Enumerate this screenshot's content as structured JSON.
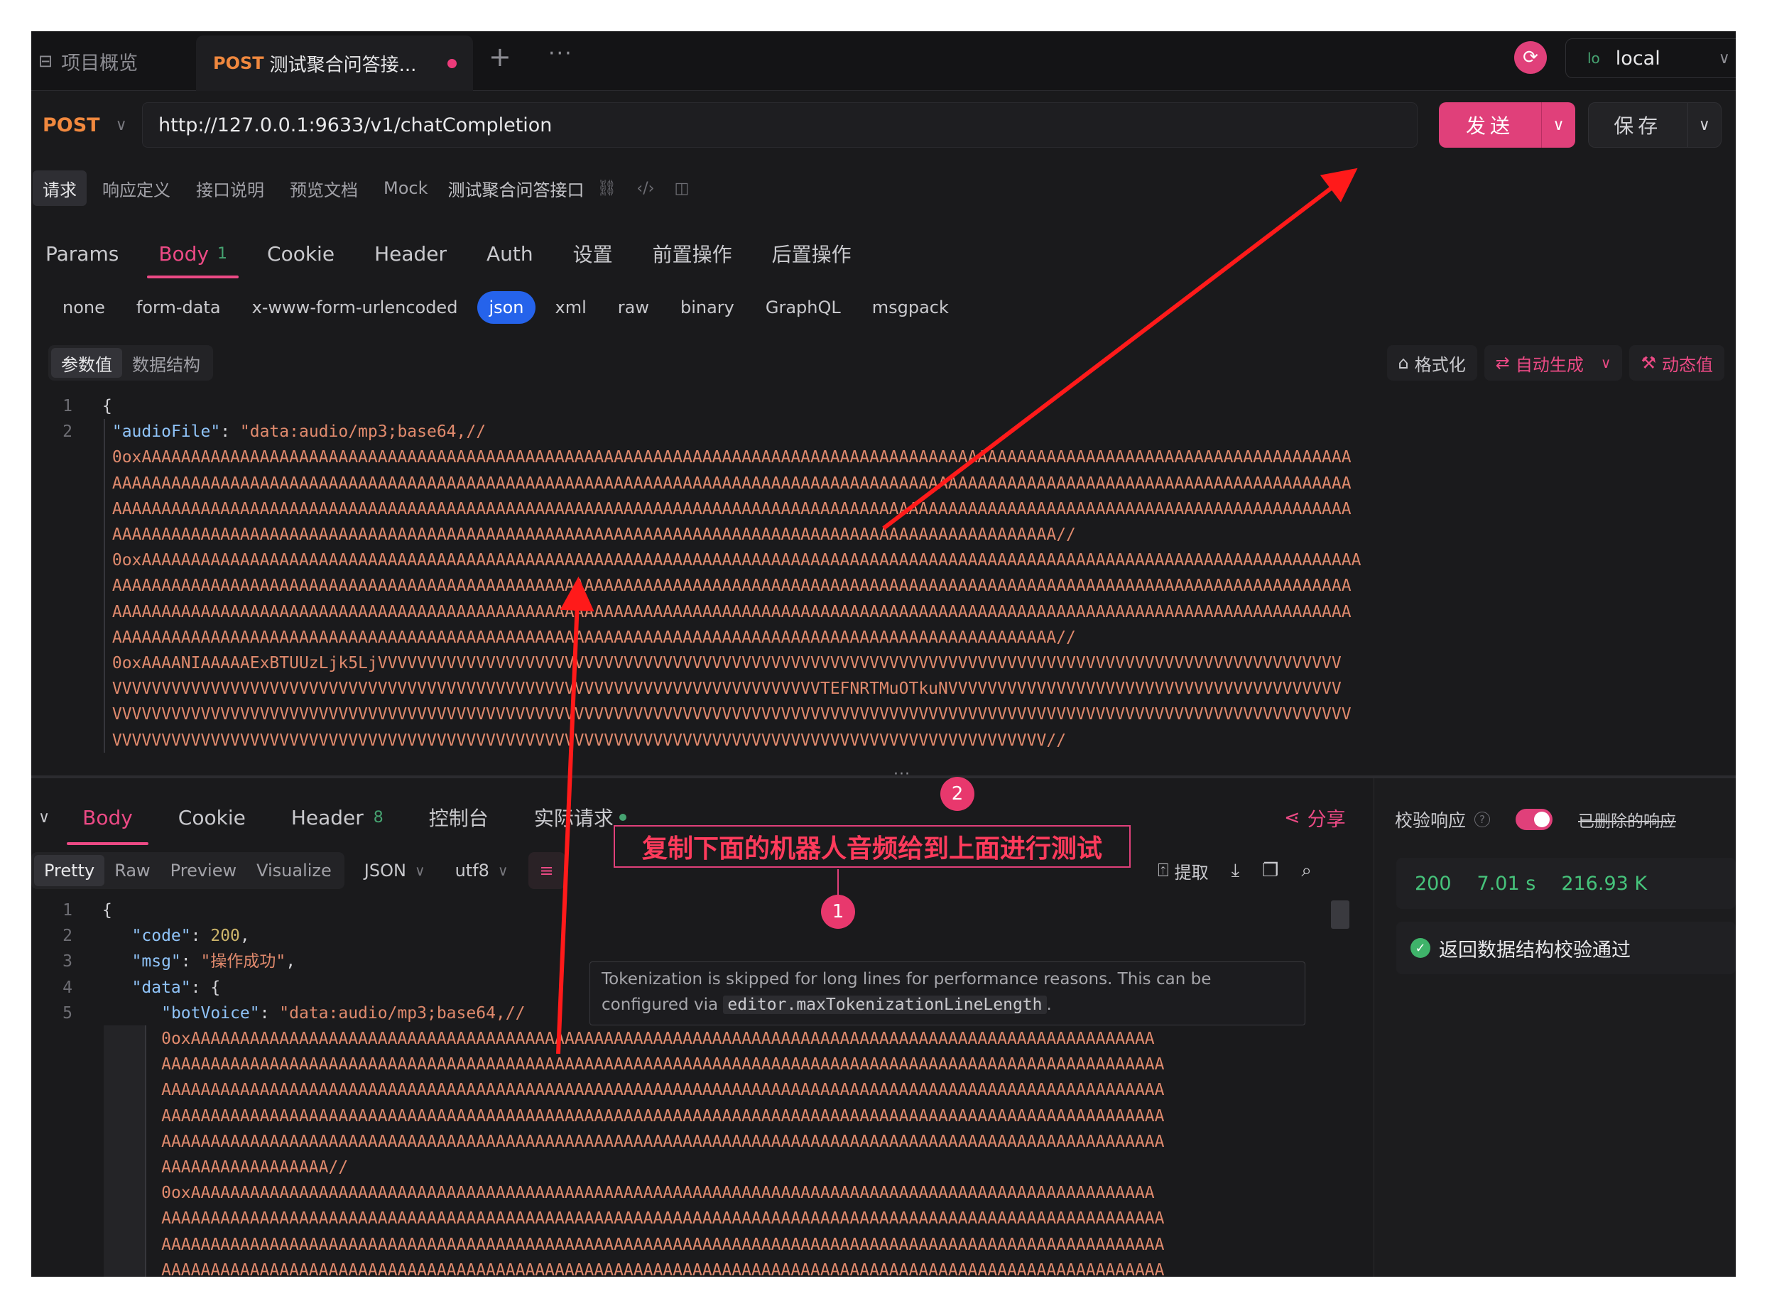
{
  "tabs": {
    "overview_label": "项目概览",
    "active": {
      "method": "POST",
      "name": "测试聚合问答接..."
    },
    "add": "+",
    "more": "···"
  },
  "environment": {
    "badge": "lo",
    "name": "local"
  },
  "request": {
    "method": "POST",
    "url": "http://127.0.0.1:9633/v1/chatCompletion",
    "send_label": "发送",
    "save_label": "保存"
  },
  "sub_tabs": [
    "请求",
    "响应定义",
    "接口说明",
    "预览文档",
    "Mock"
  ],
  "endpoint_title": "测试聚合问答接口",
  "param_tabs": [
    {
      "label": "Params"
    },
    {
      "label": "Body",
      "count": "1"
    },
    {
      "label": "Cookie"
    },
    {
      "label": "Header"
    },
    {
      "label": "Auth"
    },
    {
      "label": "设置"
    },
    {
      "label": "前置操作"
    },
    {
      "label": "后置操作"
    }
  ],
  "body_types": [
    "none",
    "form-data",
    "x-www-form-urlencoded",
    "json",
    "xml",
    "raw",
    "binary",
    "GraphQL",
    "msgpack"
  ],
  "value_modes": [
    "参数值",
    "数据结构"
  ],
  "request_tools": {
    "format": "格式化",
    "auto_generate": "自动生成",
    "dynamic": "动态值"
  },
  "request_body_lines": [
    {
      "num": "1",
      "text": "{"
    },
    {
      "num": "2",
      "key": "\"audioFile\"",
      "value": "\"data:audio/mp3;base64,//"
    },
    {
      "num": "",
      "value": "0oxAAAAAAAAAAAAAAAAAAAAAAAAAAAAAAAAAAAAAAAAAAAAAAAAAAAAAAAAAAAAAAAAAAAAAAAAAAAAAAAAAAAAAAAAAAAAAAAAAAAAAAAAAAAAAAAAAAAAAAAAAAA"
    },
    {
      "num": "",
      "value": "AAAAAAAAAAAAAAAAAAAAAAAAAAAAAAAAAAAAAAAAAAAAAAAAAAAAAAAAAAAAAAAAAAAAAAAAAAAAAAAAAAAAAAAAAAAAAAAAAAAAAAAAAAAAAAAAAAAAAAAAAAAAAA"
    },
    {
      "num": "",
      "value": "AAAAAAAAAAAAAAAAAAAAAAAAAAAAAAAAAAAAAAAAAAAAAAAAAAAAAAAAAAAAAAAAAAAAAAAAAAAAAAAAAAAAAAAAAAAAAAAAAAAAAAAAAAAAAAAAAAAAAAAAAAAAAA"
    },
    {
      "num": "",
      "value": "AAAAAAAAAAAAAAAAAAAAAAAAAAAAAAAAAAAAAAAAAAAAAAAAAAAAAAAAAAAAAAAAAAAAAAAAAAAAAAAAAAAAAAAAAAAAAAAA//"
    },
    {
      "num": "",
      "value": "0oxAAAAAAAAAAAAAAAAAAAAAAAAAAAAAAAAAAAAAAAAAAAAAAAAAAAAAAAAAAAAAAAAAAAAAAAAAAAAAAAAAAAAAAAAAAAAAAAAAAAAAAAAAAAAAAAAAAAAAAAAAAAA"
    },
    {
      "num": "",
      "value": "AAAAAAAAAAAAAAAAAAAAAAAAAAAAAAAAAAAAAAAAAAAAAAAAAAAAAAAAAAAAAAAAAAAAAAAAAAAAAAAAAAAAAAAAAAAAAAAAAAAAAAAAAAAAAAAAAAAAAAAAAAAAAA"
    },
    {
      "num": "",
      "value": "AAAAAAAAAAAAAAAAAAAAAAAAAAAAAAAAAAAAAAAAAAAAAAAAAAAAAAAAAAAAAAAAAAAAAAAAAAAAAAAAAAAAAAAAAAAAAAAAAAAAAAAAAAAAAAAAAAAAAAAAAAAAAA"
    },
    {
      "num": "",
      "value": "AAAAAAAAAAAAAAAAAAAAAAAAAAAAAAAAAAAAAAAAAAAAAAAAAAAAAAAAAAAAAAAAAAAAAAAAAAAAAAAAAAAAAAAAAAAAAAAA//"
    },
    {
      "num": "",
      "value": "0oxAAAANIAAAAAExBTUUzLjk5LjVVVVVVVVVVVVVVVVVVVVVVVVVVVVVVVVVVVVVVVVVVVVVVVVVVVVVVVVVVVVVVVVVVVVVVVVVVVVVVVVVVVVVVVVVVVVVVVVVV"
    },
    {
      "num": "",
      "value": "VVVVVVVVVVVVVVVVVVVVVVVVVVVVVVVVVVVVVVVVVVVVVVVVVVVVVVVVVVVVVVVVVVVVVVVVTEFNRTMuOTkuNVVVVVVVVVVVVVVVVVVVVVVVVVVVVVVVVVVVVVVVV"
    },
    {
      "num": "",
      "value": "VVVVVVVVVVVVVVVVVVVVVVVVVVVVVVVVVVVVVVVVVVVVVVVVVVVVVVVVVVVVVVVVVVVVVVVVVVVVVVVVVVVVVVVVVVVVVVVVVVVVVVVVVVVVVVVVVVVVVVVVVVVVVV"
    },
    {
      "num": "",
      "value": "VVVVVVVVVVVVVVVVVVVVVVVVVVVVVVVVVVVVVVVVVVVVVVVVVVVVVVVVVVVVVVVVVVVVVVVVVVVVVVVVVVVVVVVVVVVVVVV//"
    }
  ],
  "response": {
    "tabs": [
      {
        "label": "Body"
      },
      {
        "label": "Cookie"
      },
      {
        "label": "Header",
        "count": "8"
      },
      {
        "label": "控制台"
      },
      {
        "label": "实际请求"
      }
    ],
    "share_label": "分享",
    "formats": [
      "Pretty",
      "Raw",
      "Preview",
      "Visualize"
    ],
    "language": "JSON",
    "encoding": "utf8",
    "extract_label": "提取",
    "lines": [
      {
        "num": "1",
        "text": "{"
      },
      {
        "num": "2",
        "key": "\"code\"",
        "number": "200"
      },
      {
        "num": "3",
        "key": "\"msg\"",
        "value": "\"操作成功\""
      },
      {
        "num": "4",
        "key": "\"data\"",
        "text": "{"
      },
      {
        "num": "5",
        "key": "\"botVoice\"",
        "value": "\"data:audio/mp3;base64,//"
      },
      {
        "num": "",
        "value": "0oxAAAAAAAAAAAAAAAAAAAAAAAAAAAAAAAAAAAAAAAAAAAAAAAAAAAAAAAAAAAAAAAAAAAAAAAAAAAAAAAAAAAAAAAAAAAAAAAAAA"
      },
      {
        "num": "",
        "value": "AAAAAAAAAAAAAAAAAAAAAAAAAAAAAAAAAAAAAAAAAAAAAAAAAAAAAAAAAAAAAAAAAAAAAAAAAAAAAAAAAAAAAAAAAAAAAAAAAAAAAA"
      },
      {
        "num": "",
        "value": "AAAAAAAAAAAAAAAAAAAAAAAAAAAAAAAAAAAAAAAAAAAAAAAAAAAAAAAAAAAAAAAAAAAAAAAAAAAAAAAAAAAAAAAAAAAAAAAAAAAAAA"
      },
      {
        "num": "",
        "value": "AAAAAAAAAAAAAAAAAAAAAAAAAAAAAAAAAAAAAAAAAAAAAAAAAAAAAAAAAAAAAAAAAAAAAAAAAAAAAAAAAAAAAAAAAAAAAAAAAAAAAA"
      },
      {
        "num": "",
        "value": "AAAAAAAAAAAAAAAAAAAAAAAAAAAAAAAAAAAAAAAAAAAAAAAAAAAAAAAAAAAAAAAAAAAAAAAAAAAAAAAAAAAAAAAAAAAAAAAAAAAAAA"
      },
      {
        "num": "",
        "value": "AAAAAAAAAAAAAAAAA//"
      },
      {
        "num": "",
        "value": "0oxAAAAAAAAAAAAAAAAAAAAAAAAAAAAAAAAAAAAAAAAAAAAAAAAAAAAAAAAAAAAAAAAAAAAAAAAAAAAAAAAAAAAAAAAAAAAAAAAAA"
      },
      {
        "num": "",
        "value": "AAAAAAAAAAAAAAAAAAAAAAAAAAAAAAAAAAAAAAAAAAAAAAAAAAAAAAAAAAAAAAAAAAAAAAAAAAAAAAAAAAAAAAAAAAAAAAAAAAAAAA"
      },
      {
        "num": "",
        "value": "AAAAAAAAAAAAAAAAAAAAAAAAAAAAAAAAAAAAAAAAAAAAAAAAAAAAAAAAAAAAAAAAAAAAAAAAAAAAAAAAAAAAAAAAAAAAAAAAAAAAAA"
      },
      {
        "num": "",
        "value": "AAAAAAAAAAAAAAAAAAAAAAAAAAAAAAAAAAAAAAAAAAAAAAAAAAAAAAAAAAAAAAAAAAAAAAAAAAAAAAAAAAAAAAAAAAAAAAAAAAAAAA"
      }
    ],
    "tooltip": {
      "text_before": "Tokenization is skipped for long lines for performance reasons. This can be configured via",
      "code": "editor.maxTokenizationLineLength",
      "text_after": "."
    }
  },
  "validation": {
    "label": "校验响应",
    "help": "?",
    "deleted_label": "已删除的响应",
    "status": "200",
    "time": "7.01 s",
    "size": "216.93 K",
    "result": "返回数据结构校验通过"
  },
  "annotations": {
    "instruction": "复制下面的机器人音频给到上面进行测试",
    "badge_1": "1",
    "badge_2": "2",
    "arrow_color": "#ff1a1a"
  },
  "colors": {
    "accent": "#e0407a",
    "method": "#f0883e",
    "json_key": "#8fc3f8",
    "json_string": "#e08a6d",
    "success": "#46c37b"
  }
}
